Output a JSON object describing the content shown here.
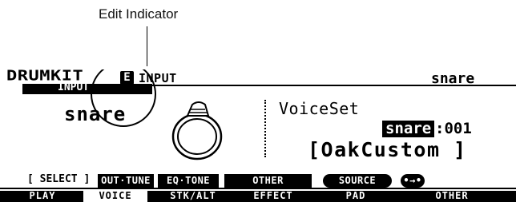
{
  "callout": {
    "label": "Edit Indicator"
  },
  "header": {
    "mode": "DRUMKIT",
    "page_tab": "INPUT",
    "edit_indicator": "E",
    "subtitle": "INPUT",
    "kit_name": "snare"
  },
  "main": {
    "input_name": "snare",
    "voice_set_label": "VoiceSet",
    "voice_category": "snare",
    "voice_number": ":001",
    "voice_name": "[OakCustom  ]"
  },
  "function_row": {
    "select_label": "[ SELECT ]",
    "buttons": [
      "OUT·TUNE",
      "EQ·TONE",
      "OTHER",
      "SOURCE",
      "•→•"
    ]
  },
  "tabs": [
    "PLAY",
    "VOICE",
    "STK/ALT",
    "EFFECT",
    "PAD",
    "OTHER"
  ],
  "active_tab": "VOICE"
}
